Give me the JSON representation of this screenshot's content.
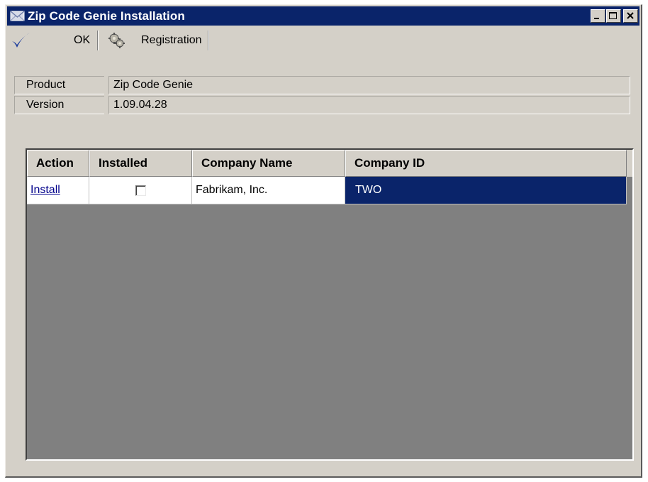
{
  "window": {
    "title": "Zip Code Genie Installation"
  },
  "toolbar": {
    "ok_label": "OK",
    "registration_label": "Registration"
  },
  "info": {
    "product_label": "Product",
    "product_value": "Zip Code Genie",
    "version_label": "Version",
    "version_value": "1.09.04.28"
  },
  "grid": {
    "columns": [
      "Action",
      "Installed",
      "Company Name",
      "Company ID"
    ],
    "rows": [
      {
        "action": "Install",
        "installed": false,
        "company_name": "Fabrikam, Inc.",
        "company_id": "TWO"
      }
    ]
  },
  "colors": {
    "titlebar": "#0a246a",
    "selection": "#0a246a",
    "window_face": "#d4d0c8",
    "grid_background": "#808080",
    "link": "#00008b",
    "ok_check": "#1c3c9c"
  },
  "icons": [
    "envelope-app-icon",
    "minimize-icon",
    "maximize-icon",
    "close-icon",
    "checkmark-icon",
    "gears-icon"
  ]
}
